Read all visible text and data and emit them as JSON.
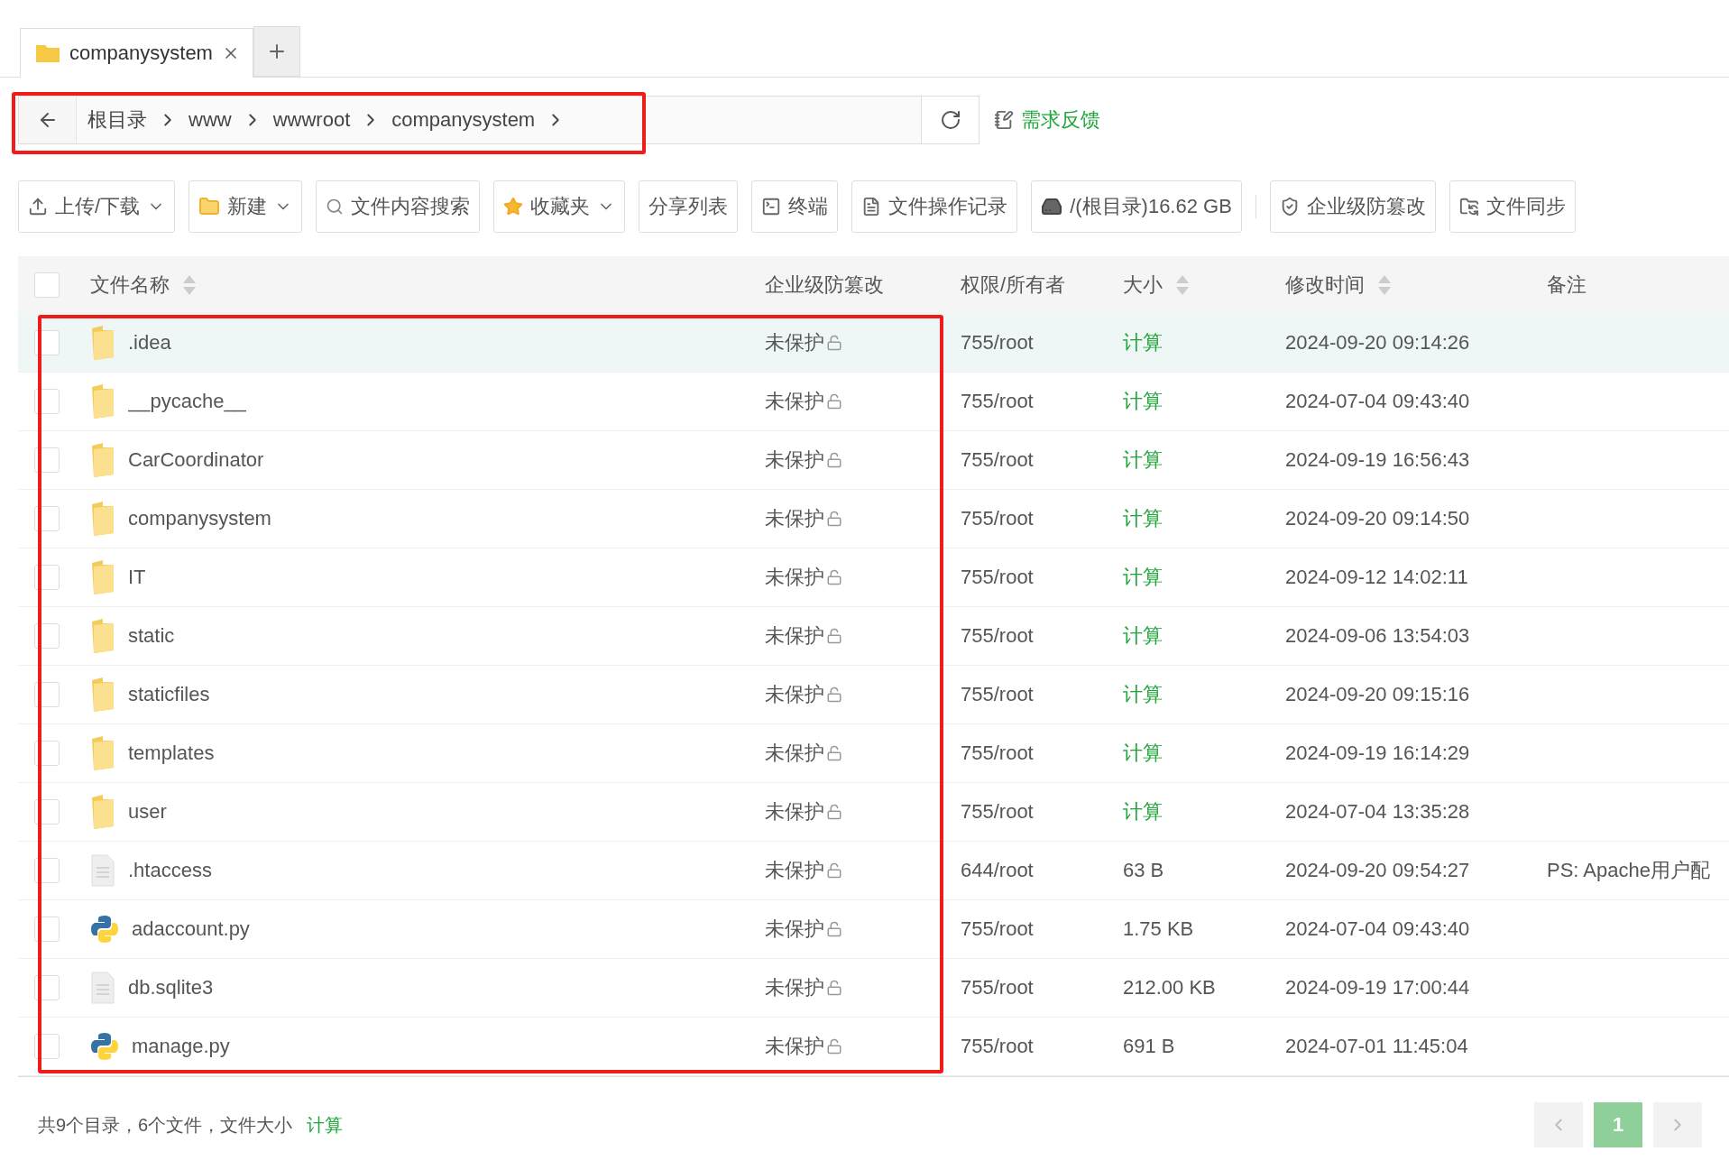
{
  "tabs": [
    {
      "label": "companysystem",
      "selected": true
    }
  ],
  "address_bar": {
    "crumbs": [
      "根目录",
      "www",
      "wwwroot",
      "companysystem"
    ],
    "feedback": "需求反馈"
  },
  "toolbar": [
    {
      "label": "上传/下载",
      "dropdown": true
    },
    {
      "label": "新建",
      "dropdown": true
    },
    {
      "label": "文件内容搜索",
      "dropdown": false
    },
    {
      "label": "收藏夹",
      "dropdown": true
    },
    {
      "label": "分享列表",
      "dropdown": false
    },
    {
      "label": "终端",
      "dropdown": false
    },
    {
      "label": "文件操作记录",
      "dropdown": false
    },
    {
      "label": "/(根目录)16.62 GB",
      "dropdown": false
    },
    {
      "label": "企业级防篡改",
      "dropdown": false
    },
    {
      "label": "文件同步",
      "dropdown": false
    }
  ],
  "table": {
    "select_all_checked": false,
    "columns": [
      {
        "label": "文件名称",
        "sortable": true
      },
      {
        "label": "企业级防篡改",
        "sortable": false
      },
      {
        "label": "权限/所有者",
        "sortable": false
      },
      {
        "label": "大小",
        "sortable": true
      },
      {
        "label": "修改时间",
        "sortable": true
      },
      {
        "label": "备注",
        "sortable": false
      }
    ],
    "rows": [
      {
        "name": ".idea",
        "kind": "folder",
        "protection": "未保护",
        "permission": "755/root",
        "size": "计算",
        "size_link": true,
        "modified": "2024-09-20 09:14:26",
        "note": "",
        "selected": true,
        "checked": false
      },
      {
        "name": "__pycache__",
        "kind": "folder",
        "protection": "未保护",
        "permission": "755/root",
        "size": "计算",
        "size_link": true,
        "modified": "2024-07-04 09:43:40",
        "note": "",
        "selected": false,
        "checked": false
      },
      {
        "name": "CarCoordinator",
        "kind": "folder",
        "protection": "未保护",
        "permission": "755/root",
        "size": "计算",
        "size_link": true,
        "modified": "2024-09-19 16:56:43",
        "note": "",
        "selected": false,
        "checked": false
      },
      {
        "name": "companysystem",
        "kind": "folder",
        "protection": "未保护",
        "permission": "755/root",
        "size": "计算",
        "size_link": true,
        "modified": "2024-09-20 09:14:50",
        "note": "",
        "selected": false,
        "checked": false
      },
      {
        "name": "IT",
        "kind": "folder",
        "protection": "未保护",
        "permission": "755/root",
        "size": "计算",
        "size_link": true,
        "modified": "2024-09-12 14:02:11",
        "note": "",
        "selected": false,
        "checked": false
      },
      {
        "name": "static",
        "kind": "folder",
        "protection": "未保护",
        "permission": "755/root",
        "size": "计算",
        "size_link": true,
        "modified": "2024-09-06 13:54:03",
        "note": "",
        "selected": false,
        "checked": false
      },
      {
        "name": "staticfiles",
        "kind": "folder",
        "protection": "未保护",
        "permission": "755/root",
        "size": "计算",
        "size_link": true,
        "modified": "2024-09-20 09:15:16",
        "note": "",
        "selected": false,
        "checked": false
      },
      {
        "name": "templates",
        "kind": "folder",
        "protection": "未保护",
        "permission": "755/root",
        "size": "计算",
        "size_link": true,
        "modified": "2024-09-19 16:14:29",
        "note": "",
        "selected": false,
        "checked": false
      },
      {
        "name": "user",
        "kind": "folder",
        "protection": "未保护",
        "permission": "755/root",
        "size": "计算",
        "size_link": true,
        "modified": "2024-07-04 13:35:28",
        "note": "",
        "selected": false,
        "checked": false
      },
      {
        "name": ".htaccess",
        "kind": "file",
        "protection": "未保护",
        "permission": "644/root",
        "size": "63 B",
        "size_link": false,
        "modified": "2024-09-20 09:54:27",
        "note": "PS: Apache用户配",
        "selected": false,
        "checked": false
      },
      {
        "name": "adaccount.py",
        "kind": "python",
        "protection": "未保护",
        "permission": "755/root",
        "size": "1.75 KB",
        "size_link": false,
        "modified": "2024-07-04 09:43:40",
        "note": "",
        "selected": false,
        "checked": false
      },
      {
        "name": "db.sqlite3",
        "kind": "file",
        "protection": "未保护",
        "permission": "755/root",
        "size": "212.00 KB",
        "size_link": false,
        "modified": "2024-09-19 17:00:44",
        "note": "",
        "selected": false,
        "checked": false
      },
      {
        "name": "manage.py",
        "kind": "python",
        "protection": "未保护",
        "permission": "755/root",
        "size": "691 B",
        "size_link": false,
        "modified": "2024-07-01 11:45:04",
        "note": "",
        "selected": false,
        "checked": false
      }
    ]
  },
  "footer": {
    "summary": "共9个目录，6个文件，文件大小",
    "calc_link": "计算",
    "pages": [
      {
        "label": "1",
        "selected": true
      }
    ]
  }
}
